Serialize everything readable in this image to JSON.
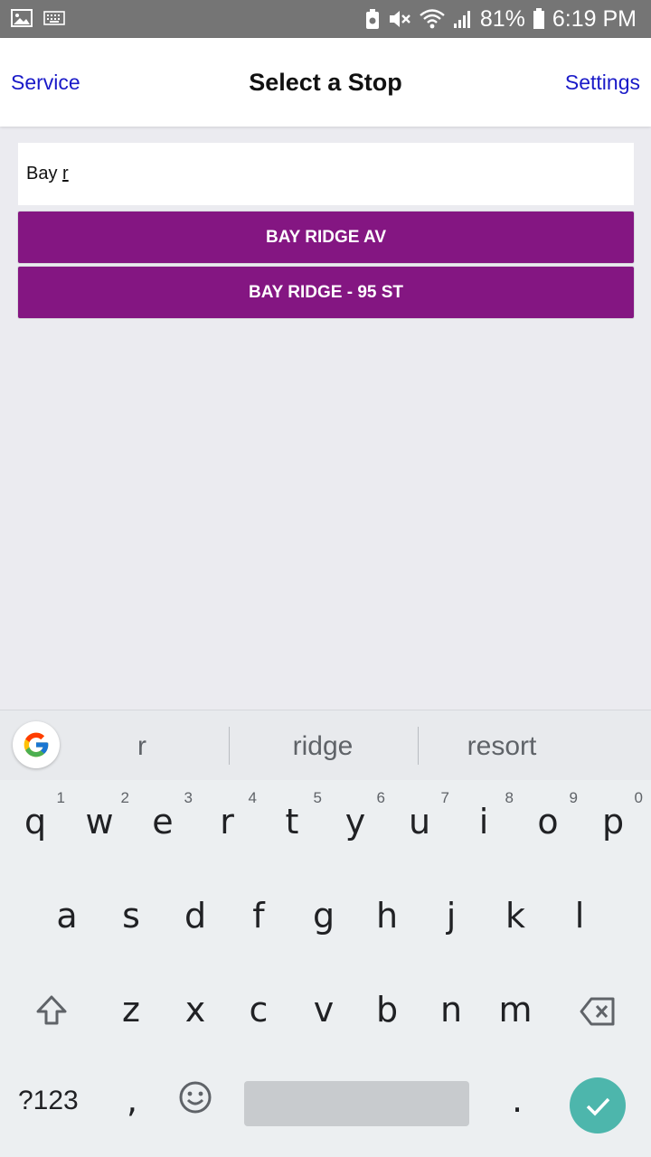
{
  "status_bar": {
    "battery_percent": "81%",
    "time": "6:19 PM"
  },
  "navbar": {
    "left": "Service",
    "title": "Select a Stop",
    "right": "Settings"
  },
  "search": {
    "value": "Bay r",
    "typed_prefix": "Bay ",
    "composing": "r"
  },
  "results": [
    {
      "label": "BAY RIDGE AV"
    },
    {
      "label": "BAY RIDGE - 95 ST"
    }
  ],
  "colors": {
    "accent": "#841682",
    "link": "#1a1ac8",
    "enter": "#4db6ac"
  },
  "keyboard": {
    "suggestions": [
      "r",
      "ridge",
      "resort"
    ],
    "row1": [
      {
        "ch": "q",
        "hint": "1"
      },
      {
        "ch": "w",
        "hint": "2"
      },
      {
        "ch": "e",
        "hint": "3"
      },
      {
        "ch": "r",
        "hint": "4"
      },
      {
        "ch": "t",
        "hint": "5"
      },
      {
        "ch": "y",
        "hint": "6"
      },
      {
        "ch": "u",
        "hint": "7"
      },
      {
        "ch": "i",
        "hint": "8"
      },
      {
        "ch": "o",
        "hint": "9"
      },
      {
        "ch": "p",
        "hint": "0"
      }
    ],
    "row2": [
      "a",
      "s",
      "d",
      "f",
      "g",
      "h",
      "j",
      "k",
      "l"
    ],
    "row3": [
      "z",
      "x",
      "c",
      "v",
      "b",
      "n",
      "m"
    ],
    "symbols_label": "?123",
    "comma": ",",
    "period": "."
  }
}
